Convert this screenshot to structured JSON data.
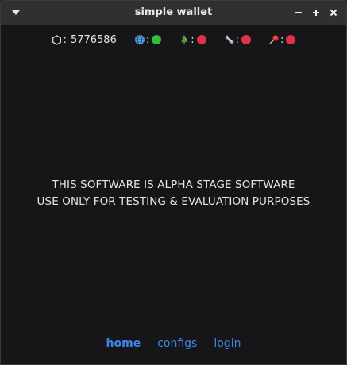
{
  "window": {
    "title": "simple wallet"
  },
  "status": {
    "block_height": "5776586",
    "separator": ":",
    "colors": {
      "ok": "#2fbf3a",
      "error": "#e0324a"
    },
    "indicators": [
      {
        "icon": "globe-icon",
        "state": "ok"
      },
      {
        "icon": "tree-icon",
        "state": "error"
      },
      {
        "icon": "satellite-icon",
        "state": "error"
      },
      {
        "icon": "pin-icon",
        "state": "error"
      }
    ]
  },
  "notice": {
    "line1": "THIS SOFTWARE IS ALPHA STAGE SOFTWARE",
    "line2": "USE ONLY FOR TESTING & EVALUATION PURPOSES"
  },
  "nav": {
    "home": "home",
    "configs": "configs",
    "login": "login",
    "active": "home",
    "link_color": "#3d86e6"
  }
}
